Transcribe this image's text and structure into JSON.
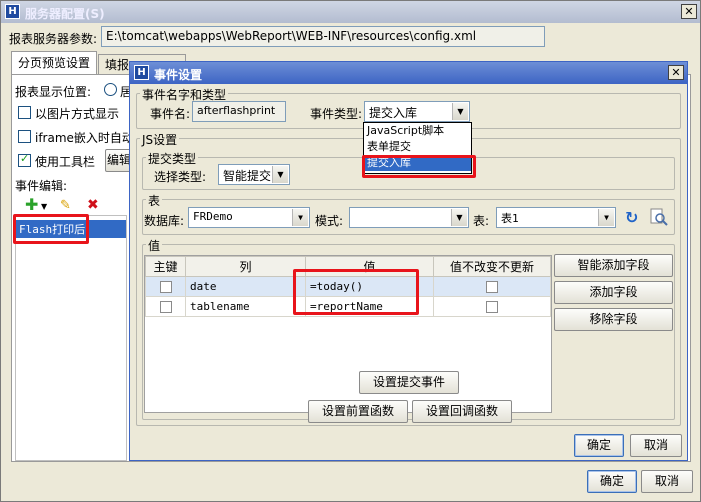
{
  "outer_window": {
    "title": "服务器配置(S)",
    "path_label": "报表服务器参数:",
    "path_value": "E:\\tomcat\\webapps\\WebReport\\WEB-INF\\resources\\config.xml",
    "tabs": [
      "分页预览设置",
      "填报"
    ],
    "display_position_label": "报表显示位置:",
    "radio_label": "居",
    "checkbox_image": "以图片方式显示",
    "checkbox_iframe": "iframe嵌入时自动",
    "checkbox_toolbar": "使用工具栏",
    "edit_button": "编辑",
    "event_edit_label": "事件编辑:",
    "event_item": "Flash打印后",
    "ok": "确定",
    "cancel": "取消"
  },
  "dialog": {
    "title": "事件设置",
    "name_type_group": "事件名字和类型",
    "event_name_label": "事件名:",
    "event_name_value": "afterflashprint",
    "event_type_label": "事件类型:",
    "event_type_value": "提交入库",
    "event_type_options": [
      "JavaScript脚本",
      "表单提交",
      "提交入库"
    ],
    "js_group": "JS设置",
    "submit_type_group": "提交类型",
    "select_type_label": "选择类型:",
    "select_type_value": "智能提交",
    "table_group": "表",
    "db_label": "数据库:",
    "db_value": "FRDemo",
    "schema_label": "模式:",
    "schema_value": "",
    "table_label": "表:",
    "table_value": "表1",
    "value_group": "值",
    "columns": [
      "主键",
      "列",
      "值",
      "值不改变不更新"
    ],
    "rows": [
      {
        "column": "date",
        "value": "=today()"
      },
      {
        "column": "tablename",
        "value": "=reportName"
      }
    ],
    "smart_add_field": "智能添加字段",
    "add_field": "添加字段",
    "remove_field": "移除字段",
    "set_submit_event": "设置提交事件",
    "set_before_func": "设置前置函数",
    "set_callback_func": "设置回调函数",
    "ok": "确定",
    "cancel": "取消"
  },
  "colors": {
    "highlight_red": "#e8141b",
    "selection_blue": "#316ac5",
    "title_blue": "#3d64c4"
  }
}
